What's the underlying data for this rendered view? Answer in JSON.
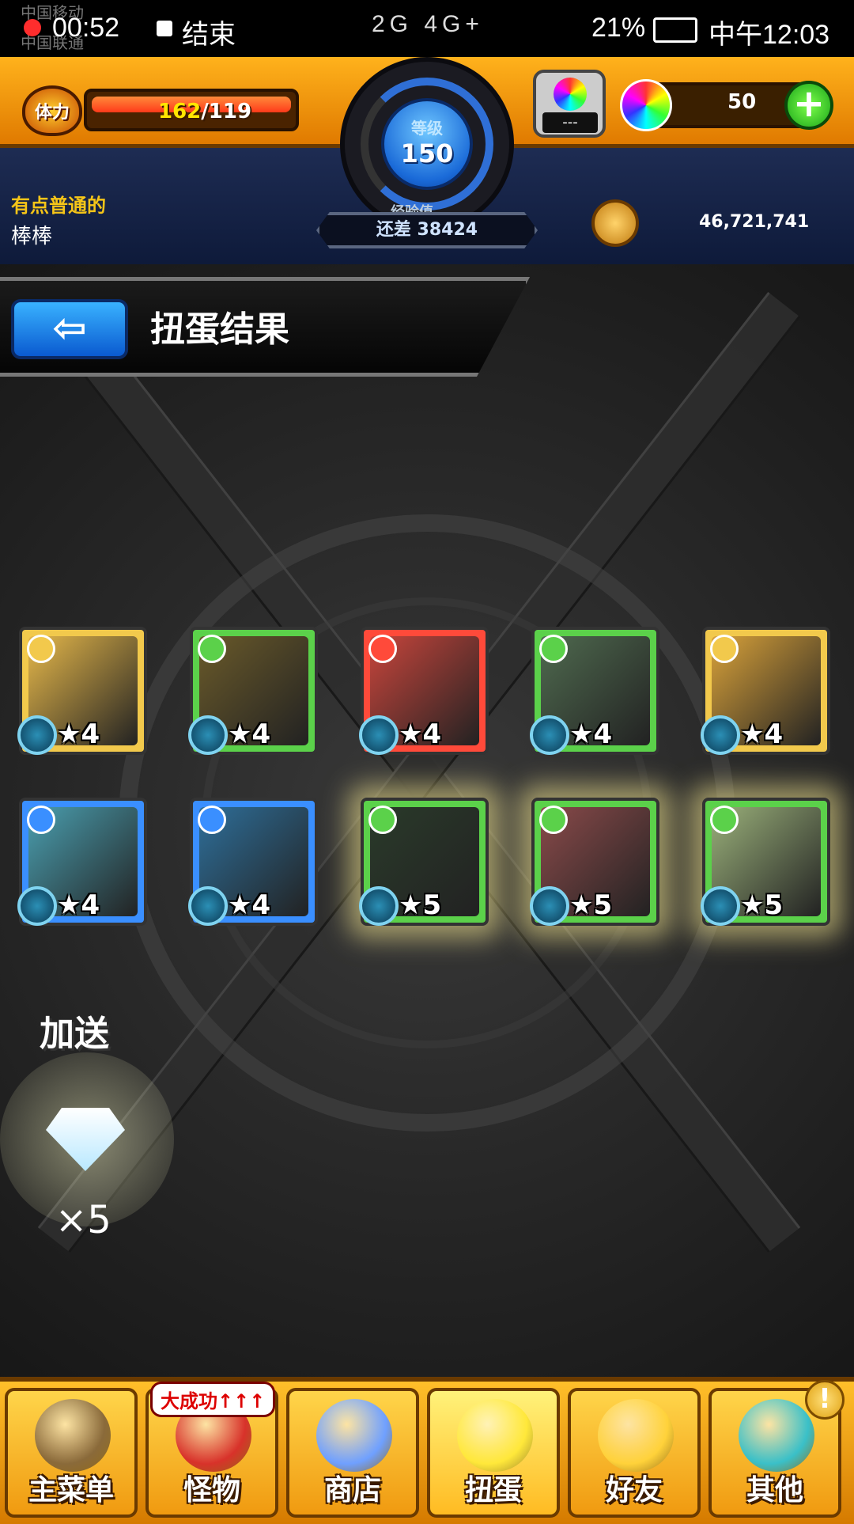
{
  "status_bar": {
    "carrier_1": "中国移动",
    "carrier_2": "中国联通",
    "recording_time": "00:52",
    "end_label": "结束",
    "network": "2G 4G+",
    "battery": "21%",
    "clock": "中午12:03"
  },
  "header": {
    "stamina_label": "体力",
    "stamina_current": "162",
    "stamina_max": "/119",
    "level_label": "等级",
    "level_value": "150",
    "exp_label": "经验值",
    "exp_remaining": "还差 38424",
    "egg_counter": "---",
    "orb_count": "50",
    "plus_label": "+",
    "player_title": "有点普通的",
    "player_name": "棒棒",
    "gold": "46,721,741"
  },
  "title_bar": {
    "back_label": "⇦",
    "title": "扭蛋结果"
  },
  "results": [
    {
      "rarity": "★4",
      "attr_color": "#f2c94c",
      "bg": "#e6b84a",
      "glow": false
    },
    {
      "rarity": "★4",
      "attr_color": "#5bd14a",
      "bg": "#6a5a2a",
      "glow": false
    },
    {
      "rarity": "★4",
      "attr_color": "#ff4a3a",
      "bg": "#c8453c",
      "glow": false
    },
    {
      "rarity": "★4",
      "attr_color": "#5bd14a",
      "bg": "#4f6a4f",
      "glow": false
    },
    {
      "rarity": "★4",
      "attr_color": "#f2c94c",
      "bg": "#d9a23a",
      "glow": false
    },
    {
      "rarity": "★4",
      "attr_color": "#3a8fff",
      "bg": "#4a9fb0",
      "glow": false
    },
    {
      "rarity": "★4",
      "attr_color": "#3a8fff",
      "bg": "#2e6f9a",
      "glow": false
    },
    {
      "rarity": "★5",
      "attr_color": "#5bd14a",
      "bg": "#2a3a2a",
      "glow": true
    },
    {
      "rarity": "★5",
      "attr_color": "#5bd14a",
      "bg": "#8a4a4a",
      "glow": true
    },
    {
      "rarity": "★5",
      "attr_color": "#5bd14a",
      "bg": "#9ab07a",
      "glow": true
    }
  ],
  "bonus": {
    "label": "加送",
    "item_icon": "diamond-icon",
    "count": "×5"
  },
  "nav": {
    "items": [
      {
        "label": "主菜单",
        "icon": "castle-gate-icon",
        "color": "#8a6a3a"
      },
      {
        "label": "怪物",
        "icon": "monster-icon",
        "color": "#d8322a"
      },
      {
        "label": "商店",
        "icon": "rainbow-orb-icon",
        "color": "#6fa0ff"
      },
      {
        "label": "扭蛋",
        "icon": "gacha-egg-icon",
        "color": "#ffe83a"
      },
      {
        "label": "好友",
        "icon": "friends-icon",
        "color": "#ffd23a"
      },
      {
        "label": "其他",
        "icon": "other-icon",
        "color": "#3ac0c8"
      }
    ],
    "monster_badge": "大成功↑↑↑",
    "alert": "!"
  }
}
